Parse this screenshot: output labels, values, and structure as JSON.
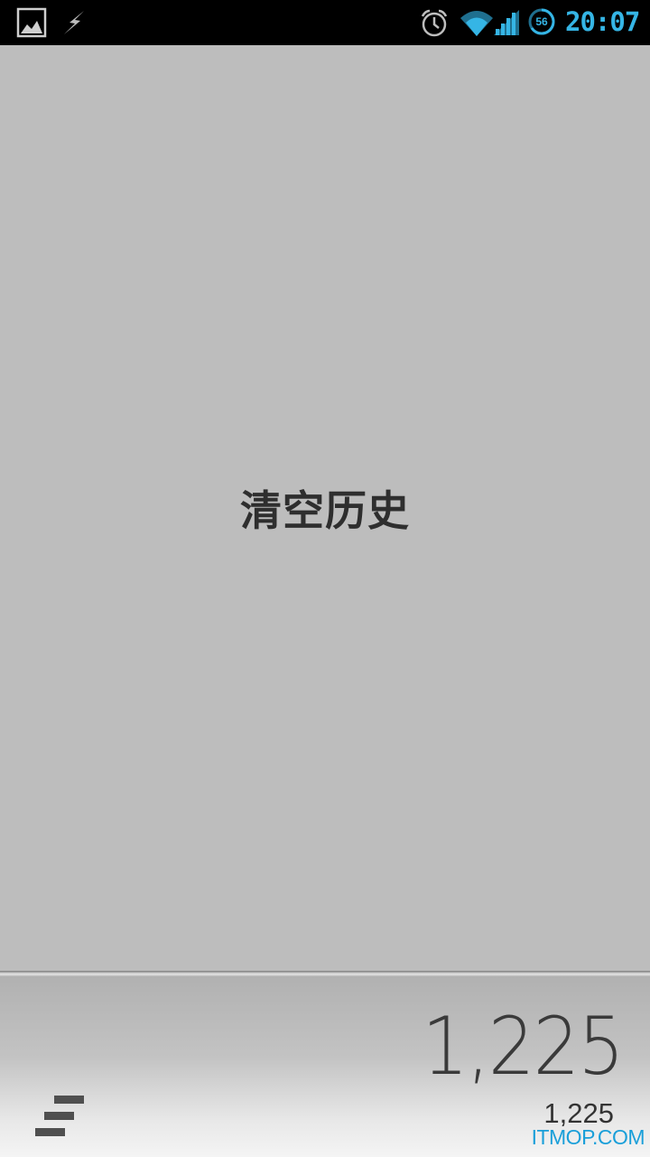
{
  "status_bar": {
    "icons": [
      "image-notification-icon",
      "lightning-icon",
      "alarm-icon",
      "wifi-icon",
      "signal-icon",
      "battery-icon"
    ],
    "battery_level": "56",
    "time": "20:07",
    "accent_color": "#35b5e5"
  },
  "history": {
    "clear_label": "清空历史"
  },
  "display": {
    "result": "1,225",
    "formula": "1,225"
  },
  "watermark": {
    "text": "ITMOP.COM",
    "color": "#1a9fd9"
  }
}
